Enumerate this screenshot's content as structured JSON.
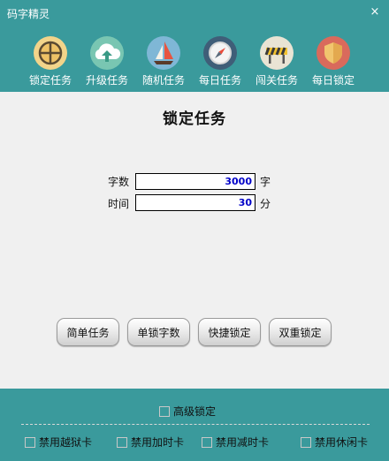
{
  "window": {
    "title": "码字精灵",
    "close_label": "×"
  },
  "toolbar": {
    "items": [
      {
        "label": "锁定任务",
        "icon": "crosshair-target-icon"
      },
      {
        "label": "升级任务",
        "icon": "cloud-upload-icon"
      },
      {
        "label": "随机任务",
        "icon": "sailboat-icon"
      },
      {
        "label": "每日任务",
        "icon": "compass-icon"
      },
      {
        "label": "闯关任务",
        "icon": "road-barrier-icon"
      },
      {
        "label": "每日锁定",
        "icon": "shield-icon"
      }
    ]
  },
  "main": {
    "title": "锁定任务",
    "fields": [
      {
        "label": "字数",
        "value": "3000",
        "unit": "字"
      },
      {
        "label": "时间",
        "value": "30",
        "unit": "分"
      }
    ],
    "buttons": [
      "简单任务",
      "单锁字数",
      "快捷锁定",
      "双重锁定"
    ]
  },
  "footer": {
    "advanced_lock": {
      "label": "高级锁定",
      "checked": false
    },
    "options": [
      {
        "label": "禁用越狱卡",
        "checked": false
      },
      {
        "label": "禁用加时卡",
        "checked": false
      },
      {
        "label": "禁用减时卡",
        "checked": false
      },
      {
        "label": "禁用休闲卡",
        "checked": false
      }
    ]
  },
  "colors": {
    "teal": "#3a9a9c",
    "panel": "#f0f0f0",
    "value_text": "#0000c8"
  }
}
